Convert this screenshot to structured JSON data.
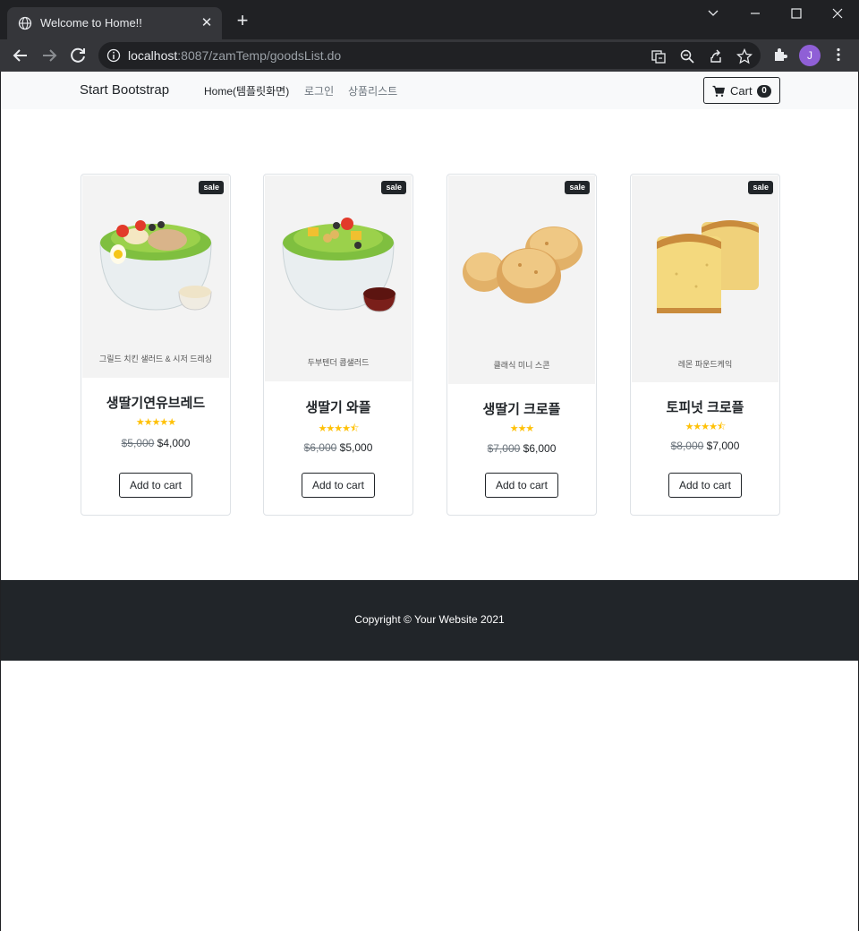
{
  "browser": {
    "tab_title": "Welcome to Home!!",
    "tab_close": "✕",
    "new_tab": "+",
    "url_host": "localhost",
    "url_rest": ":8087/zamTemp/goodsList.do",
    "avatar_letter": "J"
  },
  "navbar": {
    "brand": "Start Bootstrap",
    "links": [
      "Home(템플릿화면)",
      "로그인",
      "상품리스트"
    ],
    "cart_label": "Cart",
    "cart_count": "0"
  },
  "products": [
    {
      "badge": "sale",
      "image_caption": "그릴드 치킨 샐러드 & 시저 드레싱",
      "name": "생딸기연유브레드",
      "rating": 5,
      "old_price": "$5,000",
      "price": "$4,000",
      "button": "Add to cart"
    },
    {
      "badge": "sale",
      "image_caption": "두부텐더 콥샐러드",
      "name": "생딸기 와플",
      "rating": 4.5,
      "old_price": "$6,000",
      "price": "$5,000",
      "button": "Add to cart"
    },
    {
      "badge": "sale",
      "image_caption": "클래식 미니 스콘",
      "name": "생딸기 크로플",
      "rating": 3,
      "old_price": "$7,000",
      "price": "$6,000",
      "button": "Add to cart"
    },
    {
      "badge": "sale",
      "image_caption": "레몬 파운드케익",
      "name": "토피넛 크로플",
      "rating": 4.5,
      "old_price": "$8,000",
      "price": "$7,000",
      "button": "Add to cart"
    }
  ],
  "footer": {
    "copyright": "Copyright © Your Website 2021"
  },
  "colors": {
    "star": "#ffc107",
    "dark": "#212529",
    "navbar_bg": "#f8f9fa"
  }
}
